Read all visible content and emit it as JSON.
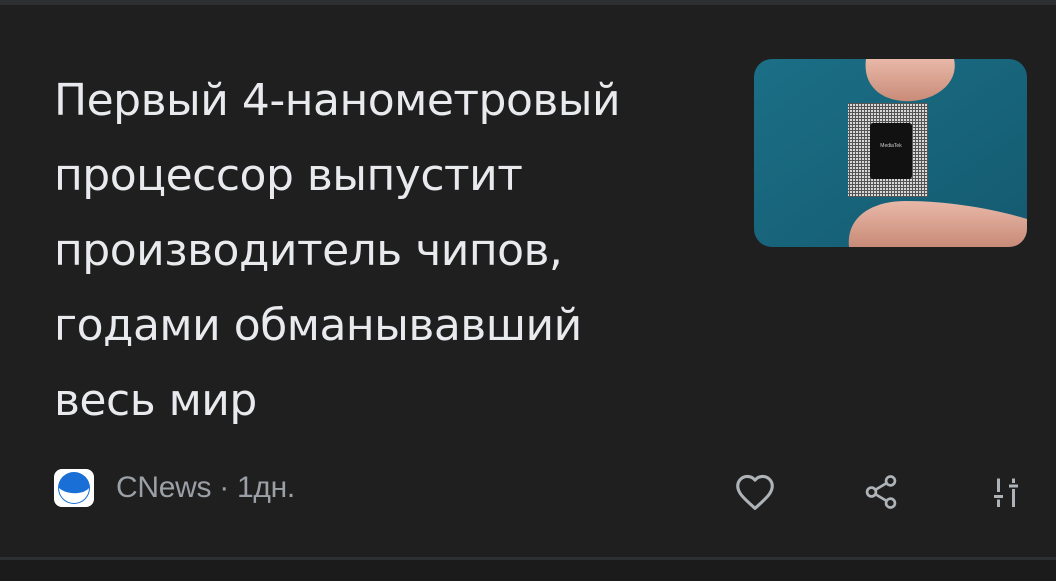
{
  "article": {
    "title_lines": [
      "Первый 4-нанометровый",
      "процессор выпустит",
      "производитель чипов,",
      "годами обманывавший",
      "весь мир"
    ],
    "source": "CNews",
    "separator": "·",
    "age": "1дн.",
    "chip_brand": "MediaTek"
  },
  "actions": {
    "like_icon": "heart-outline-icon",
    "share_icon": "share-icon",
    "more_icon": "tune-icon"
  },
  "colors": {
    "background": "#1f1f1f",
    "headline": "#e8eaed",
    "meta": "#9aa0a6",
    "icon": "#aeb3b8",
    "logo_blue": "#1a6fd6"
  }
}
